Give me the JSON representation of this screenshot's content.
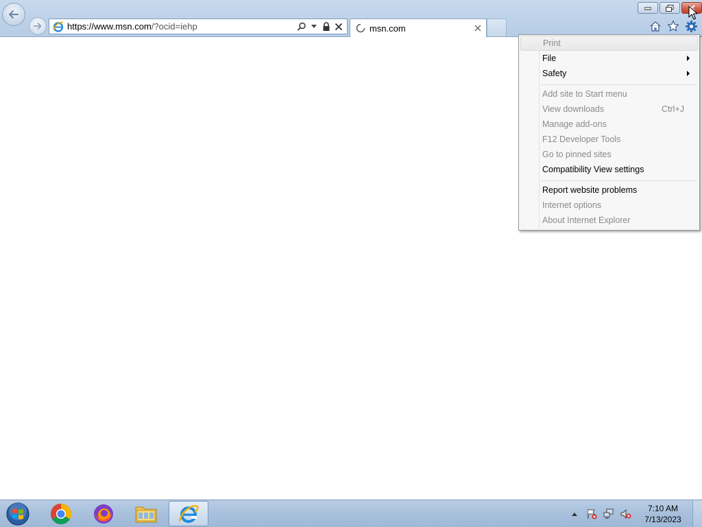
{
  "browser": {
    "address_bar": {
      "url_host": "https://www.msn.com",
      "url_rest": "/?ocid=iehp"
    },
    "tab": {
      "title": "msn.com"
    }
  },
  "tools_menu": {
    "items": [
      {
        "label": "Print",
        "disabled": true,
        "hover": true
      },
      {
        "label": "File",
        "submenu": true
      },
      {
        "label": "Safety",
        "submenu": true
      },
      {
        "label": "Add site to Start menu",
        "disabled": true
      },
      {
        "label": "View downloads",
        "disabled": true,
        "shortcut": "Ctrl+J"
      },
      {
        "label": "Manage add-ons",
        "disabled": true
      },
      {
        "label": "F12 Developer Tools",
        "disabled": true
      },
      {
        "label": "Go to pinned sites",
        "disabled": true
      },
      {
        "label": "Compatibility View settings"
      },
      {
        "label": "Report website problems"
      },
      {
        "label": "Internet options",
        "disabled": true
      },
      {
        "label": "About Internet Explorer",
        "disabled": true
      }
    ]
  },
  "taskbar": {
    "apps": [
      {
        "name": "chrome-icon"
      },
      {
        "name": "firefox-icon"
      },
      {
        "name": "file-explorer-icon"
      },
      {
        "name": "internet-explorer-icon",
        "active": true
      }
    ],
    "clock": {
      "time": "7:10 AM",
      "date": "7/13/2023"
    }
  },
  "colors": {
    "frame": "#bfd3ea",
    "menu_bg": "#f7f7f7",
    "disabled_text": "#8a8a8a",
    "close_button": "#cf5c47"
  }
}
